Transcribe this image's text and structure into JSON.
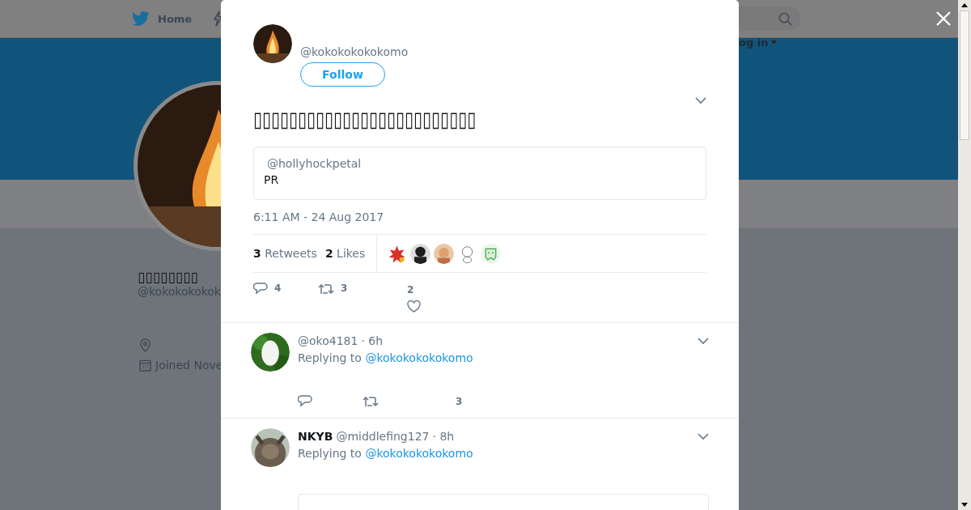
{
  "nav": {
    "home": "Home",
    "login": "og in"
  },
  "profile": {
    "name": "▯▯▯▯▯▯▯▯",
    "handle": "@kokokokokok",
    "joined": "Joined Nove"
  },
  "tweet": {
    "handle": "@kokokokokokomo",
    "follow": "Follow",
    "text": "▯▯▯▯▯▯▯▯▯▯▯▯▯▯▯▯▯▯▯▯▯▯▯▯▯",
    "quote": {
      "handle": "@hollyhockpetal",
      "text": "PR"
    },
    "time": "6:11 AM - 24 Aug 2017",
    "retweets": "3",
    "retweets_label": "Retweets",
    "likes": "2",
    "likes_label": "Likes",
    "actions": {
      "replies": "4",
      "retweets": "3",
      "likes": "2"
    }
  },
  "replies": [
    {
      "handle": "@oko4181",
      "time": "· 6h",
      "replying_label": "Replying to",
      "replying_to": "@kokokokokokomo",
      "likes": "3",
      "quote_card": false
    },
    {
      "name": "NKYB",
      "handle": "@middlefing127",
      "time": "· 8h",
      "replying_label": "Replying to",
      "replying_to": "@kokokokokokomo",
      "quote_card": true
    }
  ]
}
